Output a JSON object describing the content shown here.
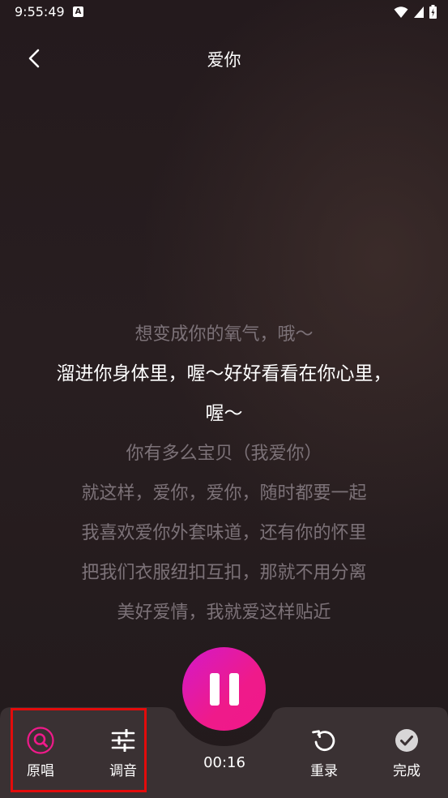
{
  "status_bar": {
    "time": "9:55:49",
    "notification_badge": "A"
  },
  "header": {
    "title": "爱你"
  },
  "lyrics": [
    {
      "text": "想变成你的氧气，哦～",
      "current": false
    },
    {
      "text": "溜进你身体里，喔～好好看看在你心里，",
      "current": true
    },
    {
      "text": "喔～",
      "current": true
    },
    {
      "text": "你有多么宝贝（我爱你）",
      "current": false
    },
    {
      "text": "就这样，爱你，爱你，随时都要一起",
      "current": false
    },
    {
      "text": "我喜欢爱你外套味道，还有你的怀里",
      "current": false
    },
    {
      "text": "把我们衣服纽扣互扣，那就不用分离",
      "current": false
    },
    {
      "text": "美好爱情，我就爱这样贴近",
      "current": false
    }
  ],
  "controls": {
    "original_vocal_label": "原唱",
    "tuning_label": "调音",
    "timer": "00:16",
    "rerecord_label": "重录",
    "finish_label": "完成"
  },
  "colors": {
    "accent": "#ef1a8a",
    "accent_start": "#d319c9",
    "highlight_border": "#e30b0b",
    "panel": "#3a3133"
  }
}
